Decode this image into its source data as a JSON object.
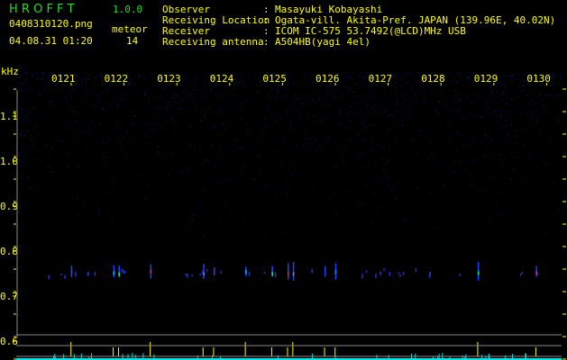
{
  "app": {
    "name": "H R O F F T",
    "version": "1.0.0"
  },
  "file": {
    "name": "0408310120.png",
    "datetime": "04.08.31 01:20"
  },
  "meteor": {
    "label": "meteor",
    "count": "14"
  },
  "info": [
    {
      "label": "Observer",
      "value": "Masayuki Kobayashi"
    },
    {
      "label": "Receiving Location",
      "value": "Ogata-vill. Akita-Pref. JAPAN (139.96E, 40.02N)"
    },
    {
      "label": "Receiver",
      "value": "ICOM IC-575 53.7492(@LCD)MHz USB"
    },
    {
      "label": "Receiving antenna",
      "value": "A504HB(yagi 4el)"
    }
  ],
  "chart_data": {
    "type": "heatmap",
    "ylabel": "kHz",
    "y_ticks": [
      "1.1",
      "1.0",
      "0.9",
      "0.8",
      "0.7",
      "0.6"
    ],
    "x_ticks": [
      "0121",
      "0122",
      "0123",
      "0124",
      "0125",
      "0126",
      "0127",
      "0128",
      "0129",
      "0130"
    ],
    "ylim": [
      0.56,
      1.2
    ],
    "meteor_echo_freq_khz": 0.755,
    "meteor_times": [
      "0121.2",
      "0122.0",
      "0122.1",
      "0122.7",
      "0123.7",
      "0123.9",
      "0124.5",
      "0125.0",
      "0125.3",
      "0125.4",
      "0126.0",
      "0126.2",
      "0128.9",
      "0130.0"
    ],
    "colors": {
      "text": "#ffff00",
      "logo": "#22dd22",
      "noise": "#1a1a80",
      "strong_count": "#ffff00",
      "count": "#00e5e5",
      "gridline": "#888888"
    }
  }
}
